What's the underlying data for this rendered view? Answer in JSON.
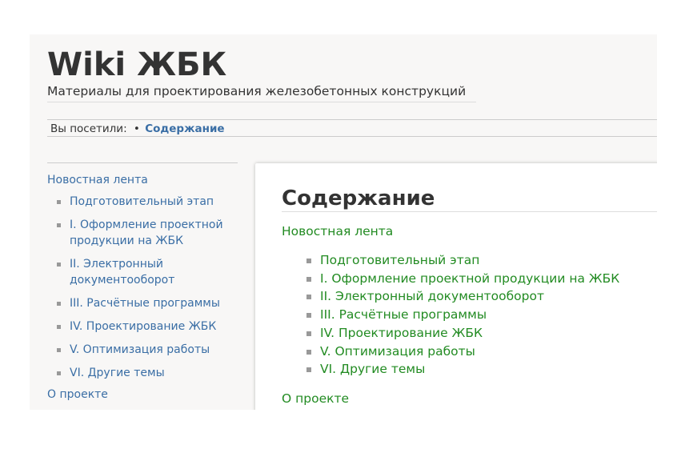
{
  "header": {
    "site_title": "Wiki ЖБК",
    "tagline": "Материалы для проектирования железобетонных конструкций"
  },
  "breadcrumb": {
    "label": "Вы посетили:",
    "separator": "•",
    "current": "Содержание"
  },
  "sidebar": {
    "top_link": "Новостная лента",
    "items": [
      {
        "label": "Подготовительный этап"
      },
      {
        "label": "I. Оформление проектной продукции на ЖБК"
      },
      {
        "label": "II. Электронный документооборот"
      },
      {
        "label": "III. Расчётные программы"
      },
      {
        "label": "IV. Проектирование ЖБК"
      },
      {
        "label": "V. Оптимизация работы"
      },
      {
        "label": "VI. Другие темы"
      }
    ],
    "bottom_link": "О проекте"
  },
  "content": {
    "title": "Содержание",
    "top_link": "Новостная лента",
    "items": [
      {
        "label": "Подготовительный этап"
      },
      {
        "label": "I. Оформление проектной продукции на ЖБК"
      },
      {
        "label": "II. Электронный документооборот"
      },
      {
        "label": "III. Расчётные программы"
      },
      {
        "label": "IV. Проектирование ЖБК"
      },
      {
        "label": "V. Оптимизация работы"
      },
      {
        "label": "VI. Другие темы"
      }
    ],
    "bottom_link": "О проекте"
  },
  "colors": {
    "sidebar_link": "#3a6ea5",
    "content_link": "#228b22",
    "title_text": "#333333",
    "panel_background": "#f8f7f6"
  }
}
